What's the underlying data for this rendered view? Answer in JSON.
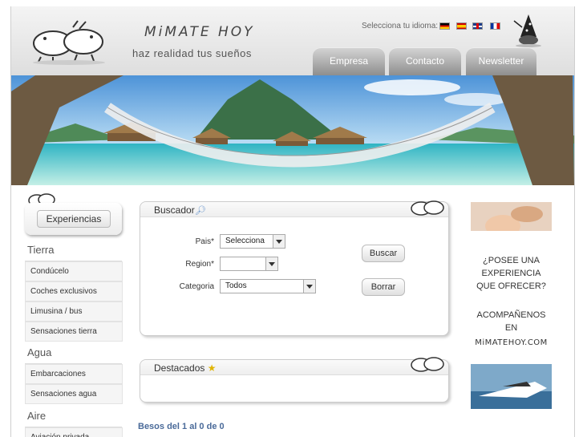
{
  "header": {
    "brand": "MiMATE HOY",
    "slogan": "haz realidad tus sueños",
    "language_label": "Selecciona tu idioma:",
    "languages": [
      "de",
      "es",
      "en",
      "fr"
    ]
  },
  "tabs": [
    {
      "label": "Empresa"
    },
    {
      "label": "Contacto"
    },
    {
      "label": "Newsletter"
    }
  ],
  "sidebar": {
    "button_label": "Experiencias",
    "categories": [
      {
        "title": "Tierra",
        "items": [
          "Condúcelo",
          "Coches exclusivos",
          "Limusina / bus",
          "Sensaciones tierra"
        ]
      },
      {
        "title": "Agua",
        "items": [
          "Embarcaciones",
          "Sensaciones agua"
        ]
      },
      {
        "title": "Aire",
        "items": [
          "Aviación privada"
        ]
      }
    ]
  },
  "search": {
    "title": "Buscador",
    "country_label": "Pais*",
    "country_value": "Selecciona",
    "region_label": "Region*",
    "region_value": "",
    "category_label": "Categoria",
    "category_value": "Todos",
    "search_button": "Buscar",
    "clear_button": "Borrar"
  },
  "featured": {
    "title": "Destacados"
  },
  "results_text": "Besos del 1 al 0 de 0",
  "ad": {
    "lines": [
      "¿POSEE UNA",
      "EXPERIENCIA",
      "QUE OFRECER?",
      "",
      "ACOMPAÑENOS",
      "EN",
      "MiMATEHOY.COM"
    ]
  },
  "colors": {
    "tab_gradient_top": "#d5d5d5",
    "tab_gradient_bottom": "#8e8e8e",
    "results_text": "#4a6a99"
  }
}
